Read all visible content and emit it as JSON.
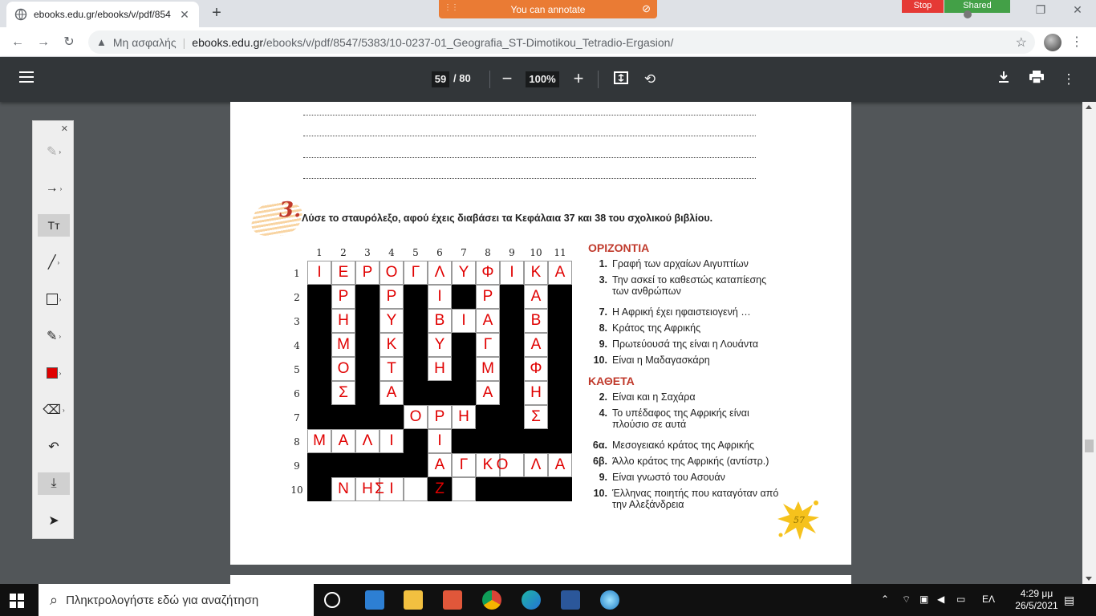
{
  "browser": {
    "tab_title": "ebooks.edu.gr/ebooks/v/pdf/854",
    "tab_close": "✕",
    "new_tab": "+",
    "annotate_label": "You can annotate",
    "stop_label": "Stop",
    "shared_label": "Shared",
    "address": {
      "warning": "Μη ασφαλής",
      "separator": "|",
      "host": "ebooks.edu.gr",
      "path": "/ebooks/v/pdf/8547/5383/10-0237-01_Geografia_ST-Dimotikou_Tetradio-Ergasion/"
    }
  },
  "pdf_toolbar": {
    "current_page": "59",
    "total_pages": "/ 80",
    "zoom": "100%"
  },
  "exercise": {
    "number": "3.",
    "instruction": "Λύσε το σταυρόλεξο, αφού έχεις διαβάσει τα Κεφάλαια 37 και 38 του σχολικού βιβλίου."
  },
  "crossword": {
    "col_numbers": [
      "1",
      "2",
      "3",
      "4",
      "5",
      "6",
      "7",
      "8",
      "9",
      "10",
      "11"
    ],
    "row_numbers": [
      "1",
      "2",
      "3",
      "4",
      "5",
      "6",
      "7",
      "8",
      "9",
      "10"
    ],
    "row_pattern": [
      "WWWWWWWWWWW",
      "BWBWBWBWBWB",
      "BWBWBWWWBWB",
      "BWBWBWBWBWB",
      "BWBWBWBWBWB",
      "BWBWBBBWBWB",
      "BBBBWWWBBWB",
      "WWWWBWBBBBB",
      "BBBBBWWWWWW",
      "BWWWWBWBBBB"
    ],
    "letters": [
      {
        "r": 1,
        "c": 1,
        "t": "Ι"
      },
      {
        "r": 1,
        "c": 2,
        "t": "Ε"
      },
      {
        "r": 1,
        "c": 3,
        "t": "Ρ"
      },
      {
        "r": 1,
        "c": 4,
        "t": "Ο"
      },
      {
        "r": 1,
        "c": 5,
        "t": "Γ"
      },
      {
        "r": 1,
        "c": 6,
        "t": "Λ"
      },
      {
        "r": 1,
        "c": 7,
        "t": "Υ"
      },
      {
        "r": 1,
        "c": 8,
        "t": "Φ"
      },
      {
        "r": 1,
        "c": 9,
        "t": "Ι"
      },
      {
        "r": 1,
        "c": 10,
        "t": "Κ"
      },
      {
        "r": 1,
        "c": 11,
        "t": "Α"
      },
      {
        "r": 2,
        "c": 2,
        "t": "Ρ"
      },
      {
        "r": 3,
        "c": 2,
        "t": "Η"
      },
      {
        "r": 4,
        "c": 2,
        "t": "Μ"
      },
      {
        "r": 5,
        "c": 2,
        "t": "Ο"
      },
      {
        "r": 6,
        "c": 2,
        "t": "Σ"
      },
      {
        "r": 2,
        "c": 4,
        "t": "Ρ"
      },
      {
        "r": 3,
        "c": 4,
        "t": "Υ"
      },
      {
        "r": 4,
        "c": 4,
        "t": "Κ"
      },
      {
        "r": 5,
        "c": 4,
        "t": "Τ"
      },
      {
        "r": 6,
        "c": 4,
        "t": "Α"
      },
      {
        "r": 2,
        "c": 6,
        "t": "Ι"
      },
      {
        "r": 3,
        "c": 6,
        "t": "Β"
      },
      {
        "r": 3,
        "c": 7,
        "t": "Ι"
      },
      {
        "r": 3,
        "c": 8,
        "t": "Α"
      },
      {
        "r": 4,
        "c": 6,
        "t": "Υ"
      },
      {
        "r": 5,
        "c": 6,
        "t": "Η"
      },
      {
        "r": 2,
        "c": 8,
        "t": "Ρ"
      },
      {
        "r": 4,
        "c": 8,
        "t": "Γ"
      },
      {
        "r": 5,
        "c": 8,
        "t": "Μ"
      },
      {
        "r": 6,
        "c": 8,
        "t": "Α"
      },
      {
        "r": 2,
        "c": 10,
        "t": "Α"
      },
      {
        "r": 3,
        "c": 10,
        "t": "Β"
      },
      {
        "r": 4,
        "c": 10,
        "t": "Α"
      },
      {
        "r": 5,
        "c": 10,
        "t": "Φ"
      },
      {
        "r": 6,
        "c": 10,
        "t": "Η"
      },
      {
        "r": 7,
        "c": 10,
        "t": "Σ"
      },
      {
        "r": 7,
        "c": 5,
        "t": "Ο"
      },
      {
        "r": 7,
        "c": 6,
        "t": "Ρ"
      },
      {
        "r": 7,
        "c": 7,
        "t": "Η"
      },
      {
        "r": 8,
        "c": 1,
        "t": "Μ"
      },
      {
        "r": 8,
        "c": 2,
        "t": "Α"
      },
      {
        "r": 8,
        "c": 3,
        "t": "Λ"
      },
      {
        "r": 8,
        "c": 4,
        "t": "Ι"
      },
      {
        "r": 8,
        "c": 6,
        "t": "Ι"
      },
      {
        "r": 9,
        "c": 6,
        "t": "Α"
      },
      {
        "r": 9,
        "c": 7,
        "t": "Γ"
      },
      {
        "r": 9,
        "c": 8,
        "t": "Κ"
      },
      {
        "r": 9,
        "c": 8.6,
        "t": "Ο"
      },
      {
        "r": 9,
        "c": 10,
        "t": "Λ"
      },
      {
        "r": 9,
        "c": 11,
        "t": "Α"
      },
      {
        "r": 10,
        "c": 6,
        "t": "Ζ"
      },
      {
        "r": 10,
        "c": 2,
        "t": "Ν"
      },
      {
        "r": 10,
        "c": 3,
        "t": "Η"
      },
      {
        "r": 10,
        "c": 3.5,
        "t": "Σ"
      },
      {
        "r": 10,
        "c": 4,
        "t": "Ι"
      }
    ]
  },
  "clues": {
    "across_title": "ΟΡΙΖΟΝΤΙΑ",
    "across": [
      {
        "n": "1.",
        "t": "Γραφή των αρχαίων Αιγυπτίων"
      },
      {
        "n": "3.",
        "t": "Την ασκεί το καθεστώς καταπίεσης των ανθρώπων"
      },
      {
        "n": "7.",
        "t": "Η Αφρική έχει ηφαιστειογενή …"
      },
      {
        "n": "8.",
        "t": "Κράτος της Αφρικής"
      },
      {
        "n": "9.",
        "t": "Πρωτεύουσά της είναι η Λουάντα"
      },
      {
        "n": "10.",
        "t": "Είναι η Μαδαγασκάρη"
      }
    ],
    "down_title": "ΚΑΘΕΤΑ",
    "down": [
      {
        "n": "2.",
        "t": "Είναι και η Σαχάρα"
      },
      {
        "n": "4.",
        "t": "Το υπέδαφος της Αφρικής είναι πλούσιο σε αυτά"
      },
      {
        "n": "6α.",
        "t": "Μεσογειακό κράτος της Αφρικής"
      },
      {
        "n": "6β.",
        "t": "Άλλο κράτος της Αφρικής (αντίστρ.)"
      },
      {
        "n": "9.",
        "t": "Είναι γνωστό του Ασουάν"
      },
      {
        "n": "10.",
        "t": "Έλληνας ποιητής που καταγόταν από την Αλεξάνδρεια"
      }
    ]
  },
  "page_number": "57",
  "taskbar": {
    "search_placeholder": "Πληκτρολογήστε εδώ για αναζήτηση",
    "language": "ΕΛ",
    "time": "4:29 μμ",
    "date": "26/5/2021"
  }
}
